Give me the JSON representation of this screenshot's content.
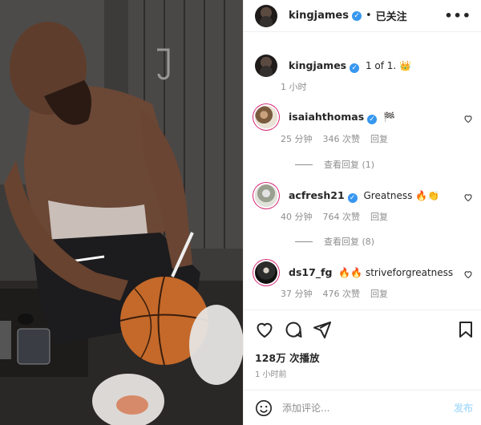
{
  "header": {
    "username": "kingjames",
    "dot": "•",
    "follow_status": "已关注",
    "more": "•••"
  },
  "caption": {
    "username": "kingjames",
    "text": "1 of 1. 👑",
    "time": "1 小时"
  },
  "comments": [
    {
      "username": "isaiahthomas",
      "text": "🏁",
      "time": "25 分钟",
      "likes": "346 次赞",
      "reply": "回复",
      "view_replies": "查看回复 (1)"
    },
    {
      "username": "acfresh21",
      "text": "Greatness 🔥👏",
      "time": "40 分钟",
      "likes": "764 次赞",
      "reply": "回复",
      "view_replies": "查看回复 (8)"
    },
    {
      "username": "ds17_fg",
      "text": "🔥🔥 striveforgreatness",
      "time": "37 分钟",
      "likes": "476 次赞",
      "reply": "回复"
    }
  ],
  "stats": {
    "views": "128万 次播放",
    "post_time": "1 小时前"
  },
  "add_comment": {
    "placeholder": "添加评论...",
    "post_label": "发布"
  },
  "icons": {
    "verified": "verified-badge-icon",
    "heart": "heart-icon",
    "comment": "comment-icon",
    "share": "share-icon",
    "save": "bookmark-icon",
    "emoji": "emoji-icon"
  },
  "colors": {
    "verified": "#3797f0",
    "post_button": "#b2dffc",
    "muted_text": "#8e8e8e"
  }
}
